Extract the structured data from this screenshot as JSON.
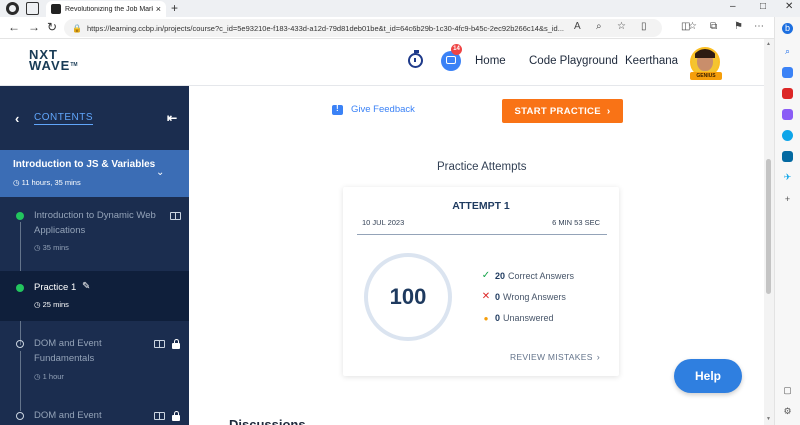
{
  "browser": {
    "tab_title": "Revolutionizing the Job Market |",
    "tab_close": "×",
    "new_tab": "+",
    "url": "https://learning.ccbp.in/projects/course?c_id=5e93210e-f183-433d-a12d-79d81deb01be&t_id=64c6b29b-1c30-4fc9-b45c-2ec92b266c14&s_id...",
    "controls": {
      "minimize": "–",
      "maximize": "□",
      "close": "✕"
    },
    "nav": {
      "back": "←",
      "forward": "→",
      "refresh": "↻",
      "lock": "🔒"
    }
  },
  "header": {
    "logo_line1": "NXT",
    "logo_line2": "WAVE",
    "logo_tm": "TM",
    "notification_count": "14",
    "home": "Home",
    "code_playground": "Code Playground",
    "user_name": "Keerthana",
    "badge": "GENIUS"
  },
  "sidebar": {
    "back": "‹",
    "contents_label": "CONTENTS",
    "collapse": "⇤",
    "module": {
      "title": "Introduction to JS & Variables",
      "duration": "11 hours, 35 mins"
    },
    "items": [
      {
        "title": "Introduction to Dynamic Web Applications",
        "duration": "35 mins",
        "status": "done"
      },
      {
        "title": "Practice 1",
        "duration": "25 mins",
        "status": "done"
      },
      {
        "title": "DOM and Event Fundamentals",
        "duration": "1 hour",
        "status": "locked"
      },
      {
        "title": "DOM and Event",
        "duration": "",
        "status": "locked"
      }
    ]
  },
  "main": {
    "feedback": "Give Feedback",
    "start_practice": "START PRACTICE",
    "practice_attempts": "Practice Attempts",
    "attempt": {
      "title": "ATTEMPT 1",
      "date": "10 JUL 2023",
      "duration": "6 MIN 53 SEC",
      "score": "100",
      "correct_count": "20",
      "correct_label": "Correct Answers",
      "wrong_count": "0",
      "wrong_label": "Wrong Answers",
      "unanswered_count": "0",
      "unanswered_label": "Unanswered",
      "review": "REVIEW MISTAKES"
    },
    "help": "Help",
    "discussions": "Discussions"
  },
  "colors": {
    "sidebar_bg": "#1b2d4f",
    "module_bg": "#3b6db5",
    "accent_orange": "#f97316",
    "help_blue": "#2f7fe0",
    "correct_green": "#22c55e",
    "wrong_red": "#dc2626",
    "unanswered_amber": "#f59e0b"
  }
}
